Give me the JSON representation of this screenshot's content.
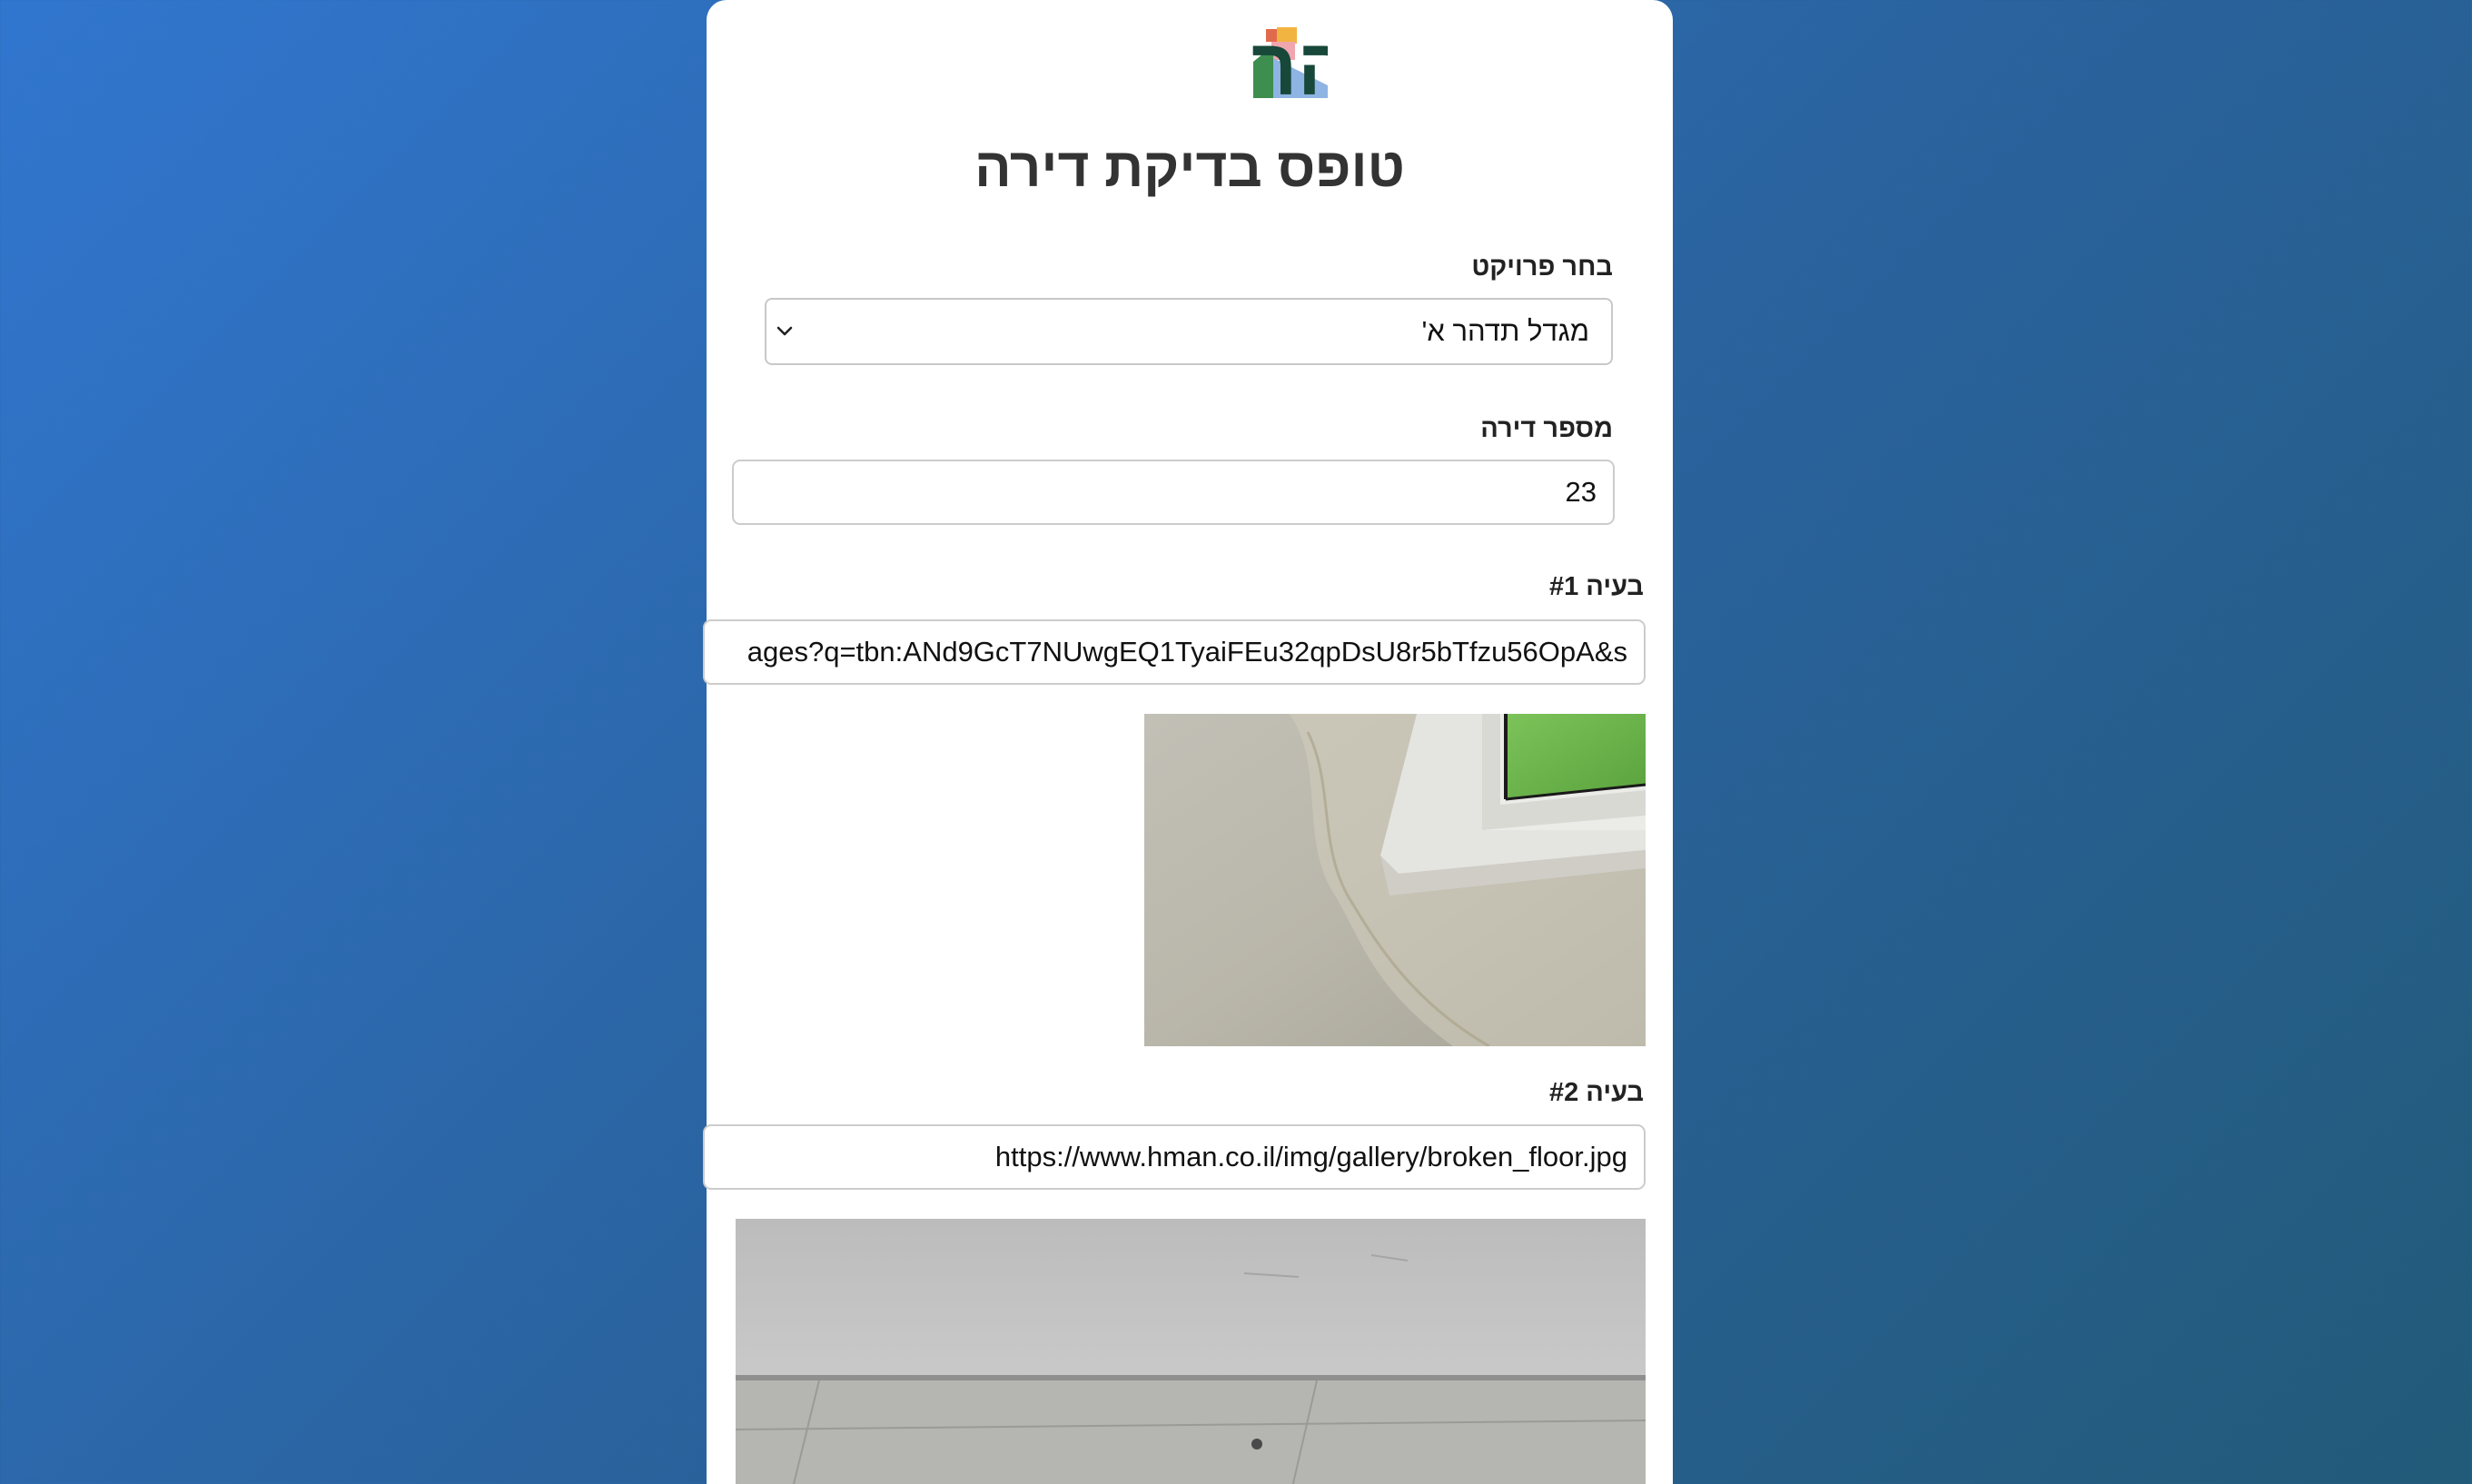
{
  "logo": {
    "text": "תדהר"
  },
  "title": "טופס בדיקת דירה",
  "project": {
    "label": "בחר פרויקט",
    "selected": "מגדל תדהר א'"
  },
  "apartment": {
    "label": "מספר דירה",
    "value": "23"
  },
  "issues": [
    {
      "label": "בעיה #1",
      "url": "ages?q=tbn:ANd9GcT7NUwgEQ1TyaiFEu32qpDsU8r5bTfzu56OpA&s",
      "image_icon": "wall-water-damage-photo"
    },
    {
      "label": "בעיה #2",
      "url": "https://www.hman.co.il/img/gallery/broken_floor.jpg",
      "image_icon": "broken-floor-photo"
    }
  ],
  "colors": {
    "logo_text": "#17483a",
    "title": "#333333",
    "background_start": "#3176cf",
    "background_end": "#225a79"
  }
}
